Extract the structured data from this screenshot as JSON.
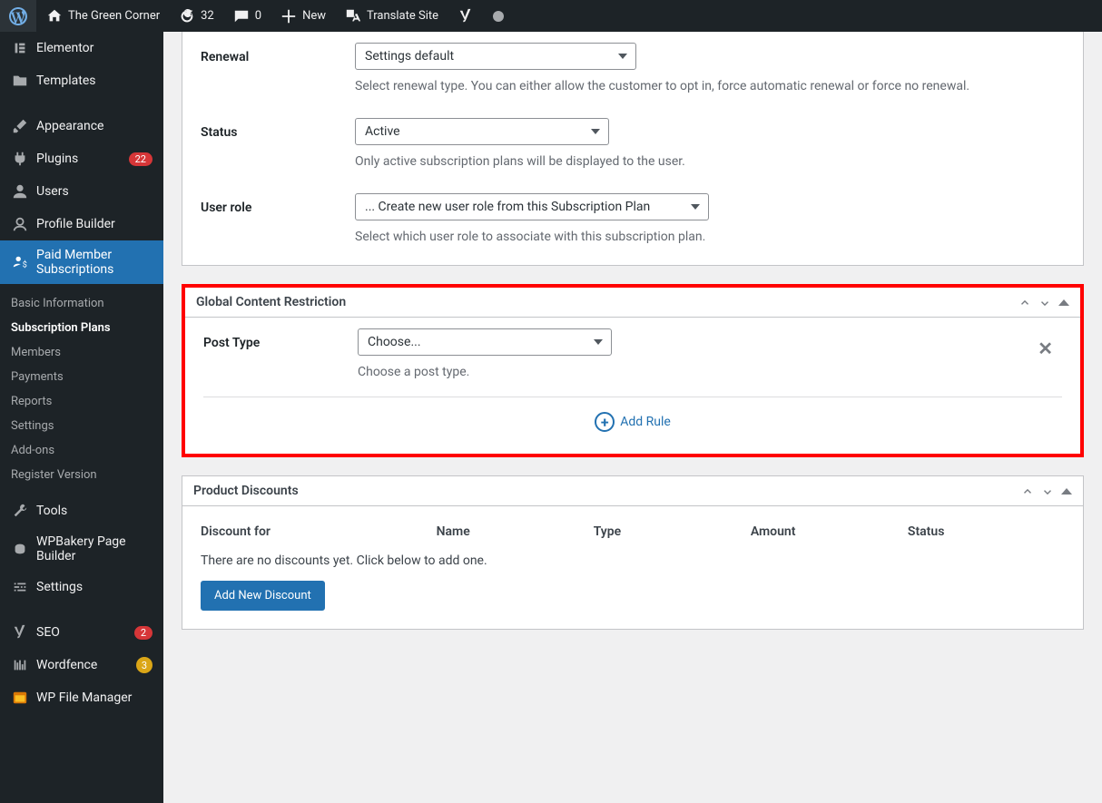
{
  "adminBar": {
    "siteTitle": "The Green Corner",
    "refreshCount": "32",
    "commentsCount": "0",
    "newLabel": "New",
    "translateLabel": "Translate Site"
  },
  "sidebar": {
    "items": {
      "elementor": "Elementor",
      "templates": "Templates",
      "appearance": "Appearance",
      "plugins": "Plugins",
      "pluginsBadge": "22",
      "users": "Users",
      "profileBuilder": "Profile Builder",
      "pms": "Paid Member Subscriptions",
      "tools": "Tools",
      "wpbakery": "WPBakery Page Builder",
      "settings": "Settings",
      "seo": "SEO",
      "seoBadge": "2",
      "wordfence": "Wordfence",
      "wordfenceBadge": "3",
      "wpfm": "WP File Manager"
    },
    "submenu": {
      "basic": "Basic Information",
      "subscription": "Subscription Plans",
      "members": "Members",
      "payments": "Payments",
      "reports": "Reports",
      "settings": "Settings",
      "addons": "Add-ons",
      "register": "Register Version"
    }
  },
  "form": {
    "renewal": {
      "label": "Renewal",
      "value": "Settings default",
      "help": "Select renewal type. You can either allow the customer to opt in, force automatic renewal or force no renewal."
    },
    "status": {
      "label": "Status",
      "value": "Active",
      "help": "Only active subscription plans will be displayed to the user."
    },
    "userRole": {
      "label": "User role",
      "value": "... Create new user role from this Subscription Plan",
      "help": "Select which user role to associate with this subscription plan."
    }
  },
  "gcr": {
    "title": "Global Content Restriction",
    "postType": {
      "label": "Post Type",
      "value": "Choose...",
      "help": "Choose a post type."
    },
    "addRule": "Add Rule"
  },
  "discounts": {
    "title": "Product Discounts",
    "headers": {
      "for": "Discount for",
      "name": "Name",
      "type": "Type",
      "amount": "Amount",
      "status": "Status"
    },
    "empty": "There are no discounts yet. Click below to add one.",
    "addButton": "Add New Discount"
  }
}
